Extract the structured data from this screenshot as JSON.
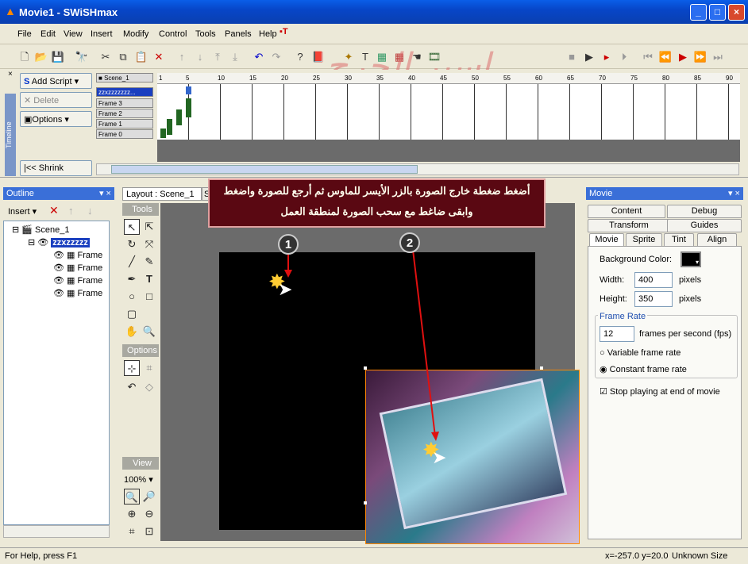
{
  "window": {
    "title": "Movie1 - SWiSHmax",
    "controls": [
      "_",
      "□",
      "×"
    ]
  },
  "menu": [
    "File",
    "Edit",
    "View",
    "Insert",
    "Modify",
    "Control",
    "Tools",
    "Panels",
    "Help"
  ],
  "timeline": {
    "side_label": "Timeline",
    "add_script": "Add Script",
    "delete": "Delete",
    "options": "Options",
    "shrink": "Shrink",
    "scene": "Scene_1",
    "rows": [
      "zzxzzzzzzz...",
      "Frame 3",
      "Frame 2",
      "Frame 1",
      "Frame 0"
    ],
    "ruler": [
      "1",
      "5",
      "10",
      "15",
      "20",
      "25",
      "30",
      "35",
      "40",
      "45",
      "50",
      "55",
      "60",
      "65",
      "70",
      "75",
      "80",
      "85",
      "90"
    ]
  },
  "outline": {
    "title": "Outline",
    "insert": "Insert",
    "scene": "Scene_1",
    "group": "zzxzzzzz",
    "frames": [
      "Frame",
      "Frame",
      "Frame",
      "Frame"
    ]
  },
  "layout": {
    "tab": "Layout : Scene_1",
    "tab2": "S",
    "tools_label": "Tools",
    "options_label": "Options",
    "view_label": "View",
    "zoom": "100%",
    "callout_line1": "أضغط ضغطة خارج الصورة بالزر الأيسر للماوس ثم أرجع للصورة واضغط",
    "callout_line2": "وابقى ضاغط مع سحب الصورة لمنطقة العمل",
    "badge1": "1",
    "badge2": "2",
    "watermark": "اسير الجرح"
  },
  "movie_panel": {
    "title": "Movie",
    "tabs_row1": [
      "Content",
      "Debug"
    ],
    "tabs_row2": [
      "Transform",
      "Guides"
    ],
    "tabs_row3": [
      "Movie",
      "Sprite",
      "Tint",
      "Align"
    ],
    "bg_color_label": "Background Color:",
    "width_label": "Width:",
    "width_value": "400",
    "width_unit": "pixels",
    "height_label": "Height:",
    "height_value": "350",
    "height_unit": "pixels",
    "frame_rate_label": "Frame Rate",
    "fps_value": "12",
    "fps_unit": "frames per second (fps)",
    "variable": "Variable frame rate",
    "constant": "Constant frame rate",
    "stop": "Stop playing at end of movie"
  },
  "status": {
    "help": "For Help, press F1",
    "coords": "x=-257.0 y=20.0",
    "size": "Unknown Size"
  }
}
